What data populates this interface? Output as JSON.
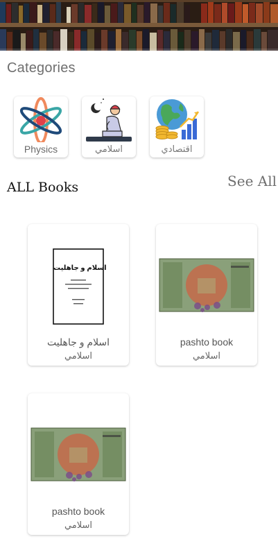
{
  "categories_section": {
    "title": "Categories",
    "items": [
      {
        "label": "Physics",
        "icon": "atom-icon"
      },
      {
        "label": "اسلامي",
        "icon": "praying-man-icon"
      },
      {
        "label": "اقتصادي",
        "icon": "economy-globe-icon"
      }
    ]
  },
  "books_section": {
    "title": "ALL Books",
    "see_all": "See All",
    "books": [
      {
        "title": "اسلام و جاهلیت",
        "category": "اسلامي",
        "cover_heading": "اسلام و جاهلیت"
      },
      {
        "title": "pashto book",
        "category": "اسلامي"
      },
      {
        "title": "pashto book",
        "category": "اسلامي"
      }
    ]
  },
  "colors": {
    "accent_text": "#6f6f6f",
    "card_bg": "#ffffff",
    "banner": "#3b2a1f"
  }
}
